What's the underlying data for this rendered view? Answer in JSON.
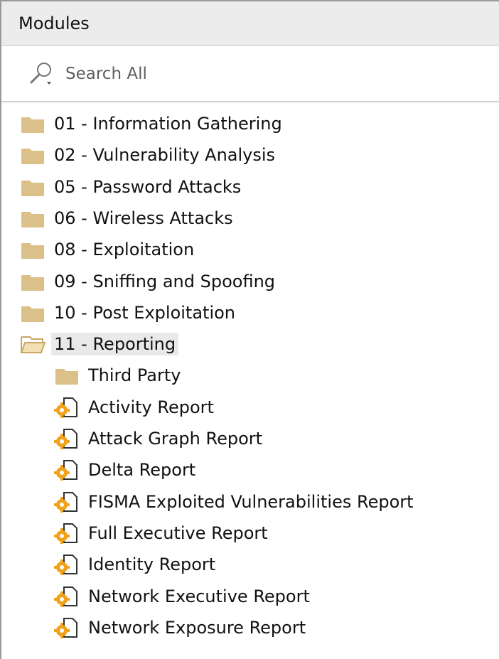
{
  "panel": {
    "title": "Modules"
  },
  "search": {
    "placeholder": "Search All"
  },
  "tree": {
    "folders": [
      {
        "label": "01 - Information Gathering",
        "icon": "folder-icon"
      },
      {
        "label": "02 - Vulnerability Analysis",
        "icon": "folder-icon"
      },
      {
        "label": "05 - Password Attacks",
        "icon": "folder-icon"
      },
      {
        "label": "06 - Wireless Attacks",
        "icon": "folder-icon"
      },
      {
        "label": "08 - Exploitation",
        "icon": "folder-icon"
      },
      {
        "label": "09 - Sniffing and Spoofing",
        "icon": "folder-icon"
      },
      {
        "label": "10 - Post Exploitation",
        "icon": "folder-icon"
      },
      {
        "label": "11 - Reporting",
        "icon": "folder-open-icon",
        "expanded": true,
        "selected": true
      }
    ],
    "reporting_children": [
      {
        "label": "Third Party",
        "icon": "folder-icon"
      },
      {
        "label": "Activity Report",
        "icon": "module-gear-icon"
      },
      {
        "label": "Attack Graph Report",
        "icon": "module-gear-icon"
      },
      {
        "label": "Delta Report",
        "icon": "module-gear-icon"
      },
      {
        "label": "FISMA Exploited Vulnerabilities Report",
        "icon": "module-gear-icon"
      },
      {
        "label": "Full Executive Report",
        "icon": "module-gear-icon"
      },
      {
        "label": "Identity Report",
        "icon": "module-gear-icon"
      },
      {
        "label": "Network Executive Report",
        "icon": "module-gear-icon"
      },
      {
        "label": "Network Exposure Report",
        "icon": "module-gear-icon"
      }
    ]
  },
  "colors": {
    "folder": "#dcc08a",
    "folder_open_outline": "#c9a866",
    "gear": "#f0a21b",
    "selection_bg": "#e9e9e9"
  }
}
